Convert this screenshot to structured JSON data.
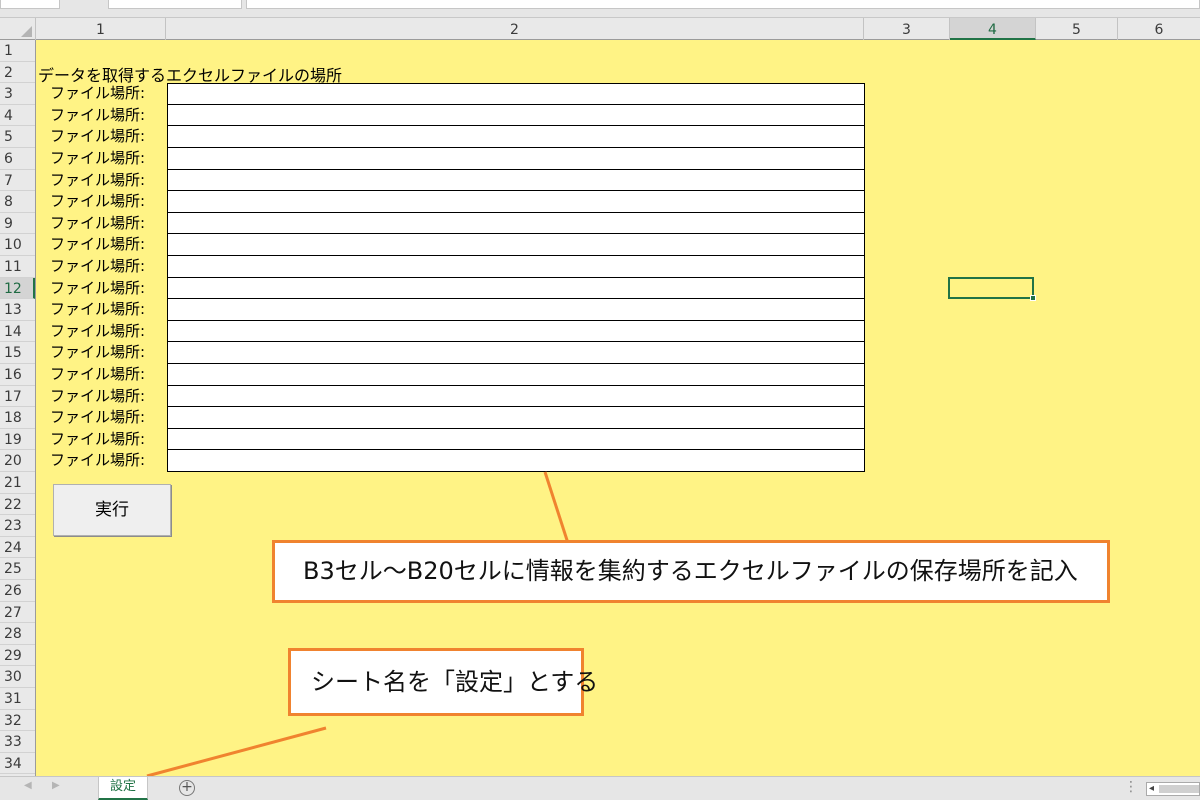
{
  "columns": [
    "1",
    "2",
    "3",
    "4",
    "5",
    "6"
  ],
  "rows": [
    "1",
    "2",
    "3",
    "4",
    "5",
    "6",
    "7",
    "8",
    "9",
    "10",
    "11",
    "12",
    "13",
    "14",
    "15",
    "16",
    "17",
    "18",
    "19",
    "20",
    "21",
    "22",
    "23",
    "24",
    "25",
    "26",
    "27",
    "28",
    "29",
    "30",
    "31",
    "32",
    "33",
    "34"
  ],
  "selected_column": "4",
  "selected_row": "12",
  "sheet": {
    "title": "データを取得するエクセルファイルの場所",
    "file_label": "ファイル場所:",
    "file_rows": 18,
    "run_button": "実行"
  },
  "callouts": {
    "range_note": "B3セル〜B20セルに情報を集約するエクセルファイルの保存場所を記入",
    "sheet_name_note": "シート名を「設定」とする"
  },
  "tabs": {
    "active_sheet": "設定",
    "add_sheet": "+",
    "options": "⋮"
  },
  "colors": {
    "sheet_background": "#fff385",
    "callout_border": "#f0832f",
    "excel_green": "#217346"
  },
  "icons": {
    "add_sheet": "plus-circle-icon",
    "nav_prev": "triangle-left-icon",
    "nav_next": "triangle-right-icon"
  }
}
